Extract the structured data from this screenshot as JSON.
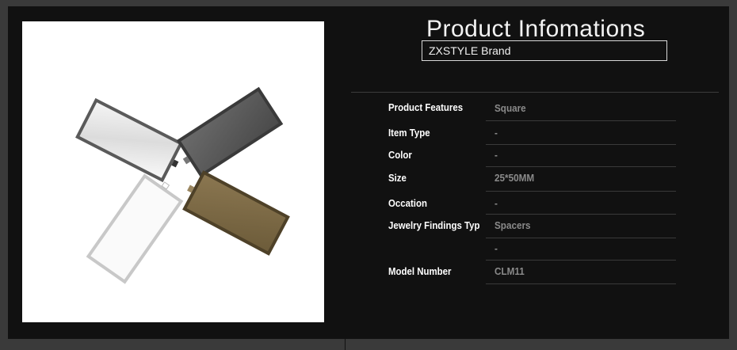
{
  "header": {
    "title": "Product Infomations",
    "brand": "ZXSTYLE Brand"
  },
  "product_image": {
    "alt": "rectangular pendant trays"
  },
  "specs": [
    {
      "label": "Product Features",
      "value": "Square"
    },
    {
      "label": "Item Type",
      "value": "-"
    },
    {
      "label": "Color",
      "value": "-"
    },
    {
      "label": "Size",
      "value": "25*50MM"
    },
    {
      "label": "Occation",
      "value": "-"
    },
    {
      "label": "Jewelry Findings Typ",
      "value": "Spacers"
    },
    {
      "label": "",
      "value": "-"
    },
    {
      "label": "Model Number",
      "value": "CLM11"
    }
  ],
  "colors": {
    "background": "#111111",
    "outer": "#3a3a3a",
    "label": "#ffffff",
    "value": "#8a8a8a"
  }
}
